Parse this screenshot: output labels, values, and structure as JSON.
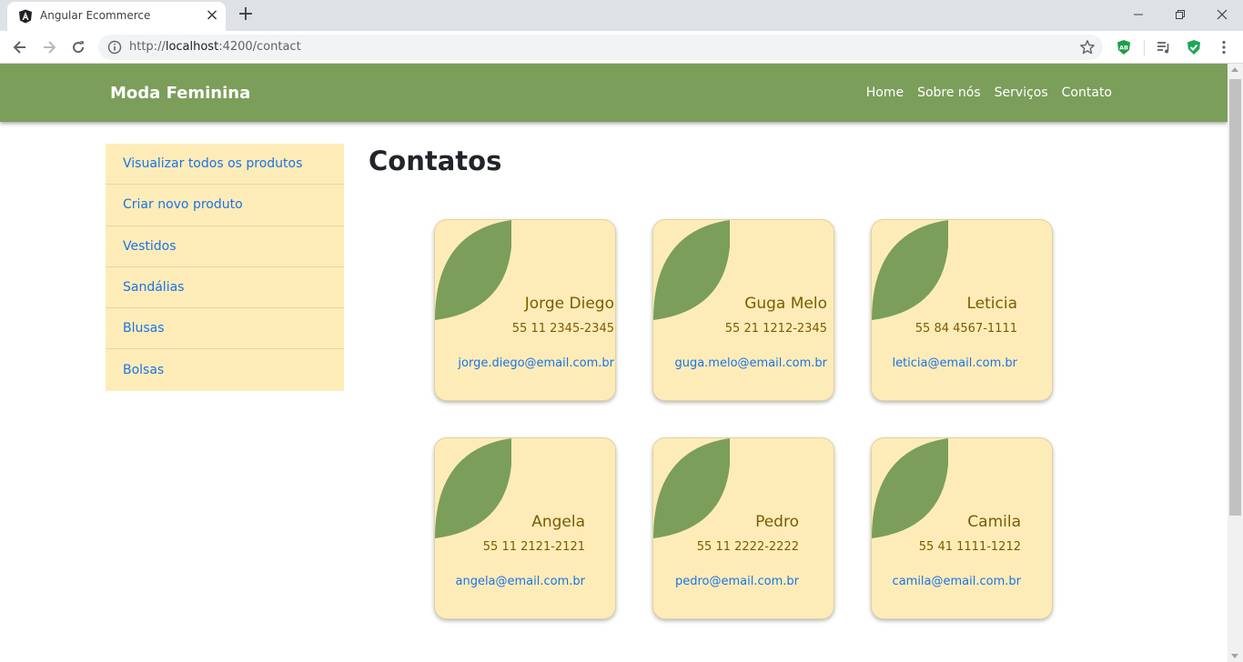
{
  "browser": {
    "tab_title": "Angular Ecommerce",
    "url_prefix": "http://",
    "url_host": "localhost",
    "url_rest": ":4200/contact"
  },
  "site": {
    "brand": "Moda Feminina",
    "nav": [
      "Home",
      "Sobre nós",
      "Serviços",
      "Contato"
    ]
  },
  "sidebar": {
    "items": [
      {
        "label": "Visualizar todos os produtos"
      },
      {
        "label": "Criar novo produto"
      },
      {
        "label": "Vestidos"
      },
      {
        "label": "Sandálias"
      },
      {
        "label": "Blusas"
      },
      {
        "label": "Bolsas"
      }
    ]
  },
  "page": {
    "title": "Contatos"
  },
  "contacts": [
    {
      "name": "Jorge Diego",
      "phone": "55 11 2345-2345",
      "email": "jorge.diego@email.com.br"
    },
    {
      "name": "Guga Melo",
      "phone": "55 21 1212-2345",
      "email": "guga.melo@email.com.br"
    },
    {
      "name": "Leticia",
      "phone": "55 84 4567-1111",
      "email": "leticia@email.com.br"
    },
    {
      "name": "Angela",
      "phone": "55 11 2121-2121",
      "email": "angela@email.com.br"
    },
    {
      "name": "Pedro",
      "phone": "55 11 2222-2222",
      "email": "pedro@email.com.br"
    },
    {
      "name": "Camila",
      "phone": "55 41 1111-1212",
      "email": "camila@email.com.br"
    }
  ],
  "colors": {
    "navbar": "#7b9e5b",
    "card_bg": "#feecb8",
    "leaf": "#7b9e5b",
    "name_text": "#7a5c00",
    "link": "#1a73e8"
  }
}
